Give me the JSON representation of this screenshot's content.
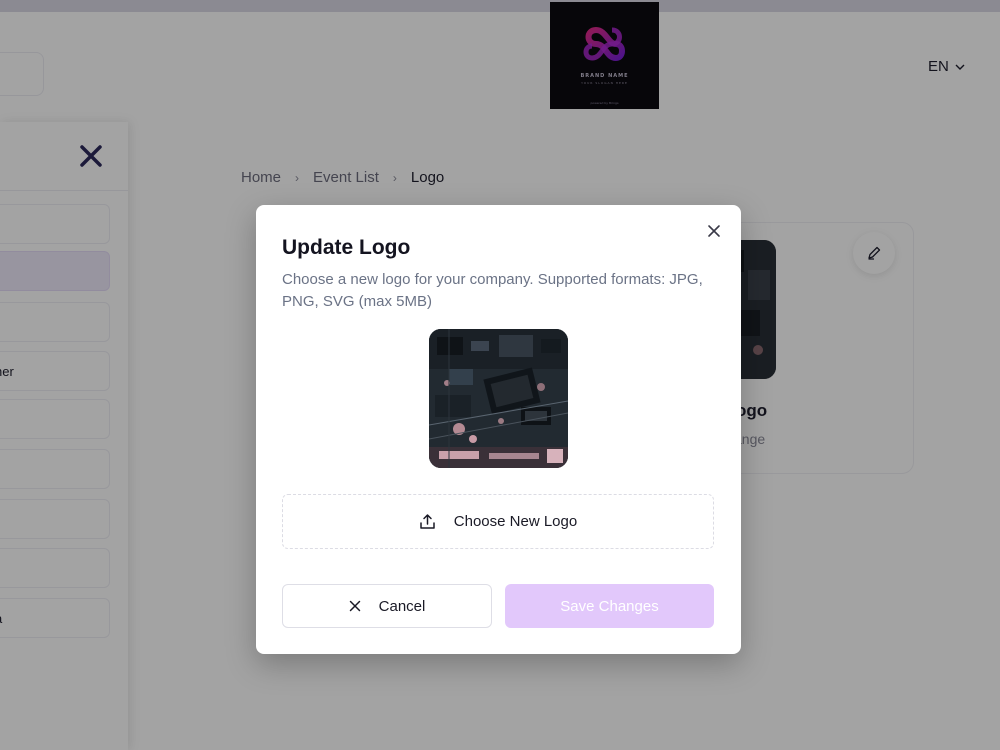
{
  "header": {
    "language": "EN",
    "brand_logo_text": "BRAND NAME",
    "brand_logo_tagline": "YOUR SLOGAN HERE",
    "brand_logo_footer": "powered by Brings"
  },
  "sidebar": {
    "items": [
      {
        "label": ""
      },
      {
        "label": ""
      },
      {
        "label": ""
      },
      {
        "label": "ner"
      },
      {
        "label": ""
      },
      {
        "label": ""
      },
      {
        "label": ""
      },
      {
        "label": ""
      },
      {
        "label": ""
      },
      {
        "label": "a"
      }
    ]
  },
  "breadcrumb": {
    "items": [
      "Home",
      "Event List",
      "Logo"
    ],
    "separator": "›"
  },
  "card": {
    "title": "ogo",
    "subtitle": "ange"
  },
  "modal": {
    "title": "Update Logo",
    "description": "Choose a new logo for your company. Supported formats: JPG, PNG, SVG (max 5MB)",
    "choose_label": "Choose New Logo",
    "cancel_label": "Cancel",
    "save_label": "Save Changes"
  },
  "colors": {
    "accent_disabled": "#e2c8fb",
    "close_icon": "#2d2a5c",
    "overlay": "rgba(0,0,0,0.36)"
  },
  "icons": [
    "close-icon",
    "chevron-down-icon",
    "upload-icon",
    "edit-icon",
    "sidebar-close-icon"
  ]
}
